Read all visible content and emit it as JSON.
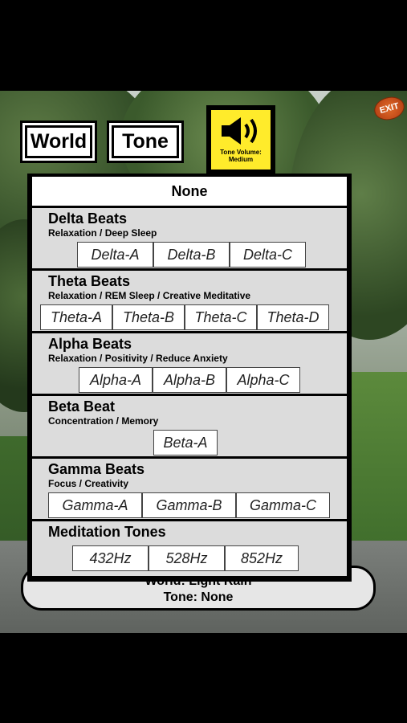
{
  "top_buttons": {
    "world": "World",
    "tone": "Tone"
  },
  "volume": {
    "label": "Tone Volume: Medium",
    "icon": "speaker-icon",
    "color": "#ffeb2b"
  },
  "exit": {
    "label": "EXIT"
  },
  "menu": {
    "none_label": "None",
    "sections": [
      {
        "title": "Delta Beats",
        "subtitle": "Relaxation / Deep Sleep",
        "options": [
          "Delta-A",
          "Delta-B",
          "Delta-C"
        ]
      },
      {
        "title": "Theta Beats",
        "subtitle": "Relaxation / REM Sleep / Creative Meditative",
        "options": [
          "Theta-A",
          "Theta-B",
          "Theta-C",
          "Theta-D"
        ]
      },
      {
        "title": "Alpha Beats",
        "subtitle": "Relaxation / Positivity / Reduce Anxiety",
        "options": [
          "Alpha-A",
          "Alpha-B",
          "Alpha-C"
        ]
      },
      {
        "title": "Beta Beat",
        "subtitle": "Concentration / Memory",
        "options": [
          "Beta-A"
        ]
      },
      {
        "title": "Gamma Beats",
        "subtitle": "Focus / Creativity",
        "options": [
          "Gamma-A",
          "Gamma-B",
          "Gamma-C"
        ]
      },
      {
        "title": "Meditation Tones",
        "subtitle": "",
        "options": [
          "432Hz",
          "528Hz",
          "852Hz"
        ]
      }
    ]
  },
  "status": {
    "world_line": "World: Light Rain",
    "tone_line": "Tone: None"
  }
}
